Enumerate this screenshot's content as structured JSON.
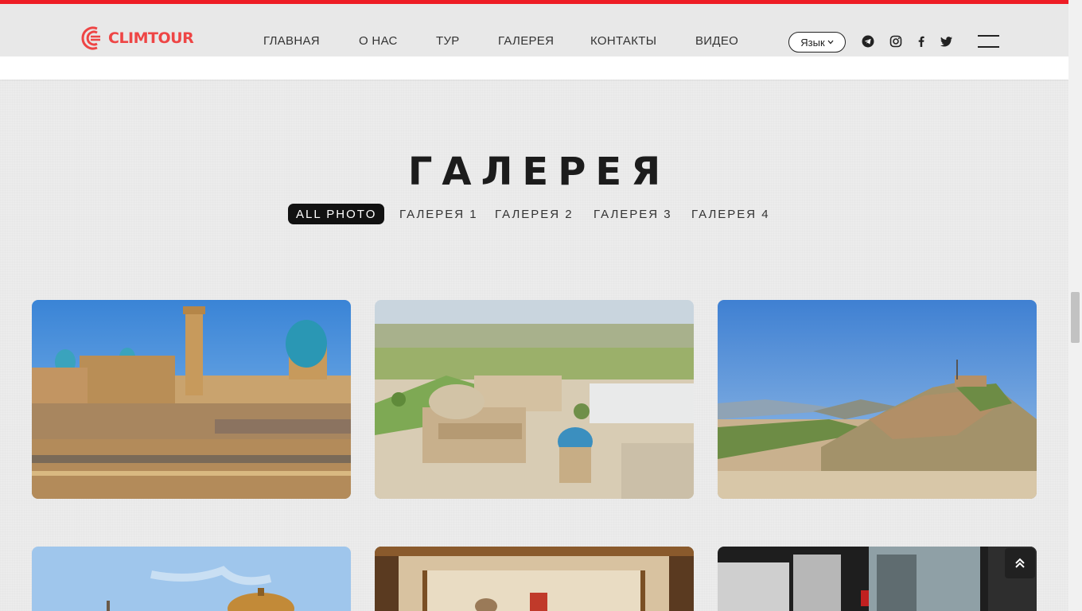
{
  "header": {
    "logo_text": "CLIMTOUR",
    "nav": [
      "ГЛАВНАЯ",
      "О НАС",
      "ТУР",
      "ГАЛЕРЕЯ",
      "КОНТАКТЫ",
      "ВИДЕО"
    ],
    "language_label": "Язык",
    "social_icons": [
      "telegram-icon",
      "instagram-icon",
      "facebook-icon",
      "twitter-icon"
    ],
    "accent_color": "#ee1c25"
  },
  "gallery": {
    "title": "ГАЛЕРЕЯ",
    "filters": [
      "ALL PHOTO",
      "ГАЛЕРЕЯ 1",
      "ГАЛЕРЕЯ 2",
      "ГАЛЕРЕЯ 3",
      "ГАЛЕРЕЯ 4"
    ],
    "active_filter": "ALL PHOTO",
    "photos": [
      "bukhara-panorama-photo",
      "mausoleum-complex-aerial-photo",
      "fortress-ruins-hill-photo",
      "dome-sky-photo",
      "museum-display-case-photo",
      "museum-exhibit-photo"
    ]
  }
}
